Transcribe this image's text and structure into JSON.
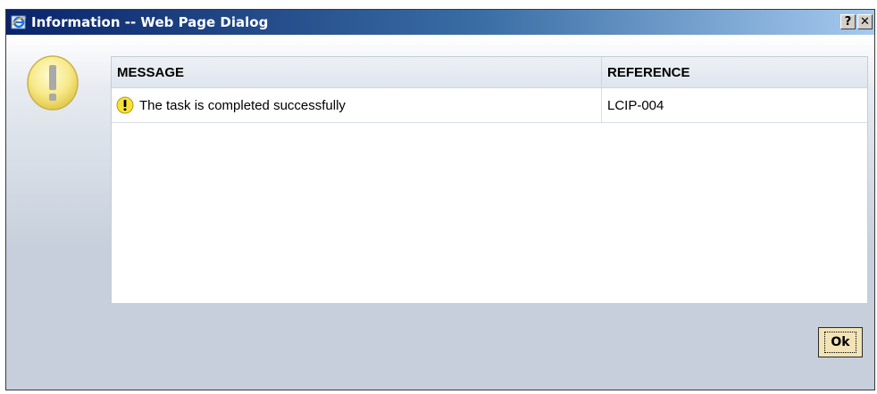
{
  "window": {
    "title": "Information -- Web Page Dialog",
    "help_label": "?",
    "close_label": "✕"
  },
  "table": {
    "headers": {
      "message": "MESSAGE",
      "reference": "REFERENCE"
    },
    "rows": [
      {
        "message": "The task is completed successfully",
        "reference": "LCIP-004",
        "icon": "warning-icon"
      }
    ]
  },
  "footer": {
    "ok_label": "Ok"
  },
  "colors": {
    "title_gradient_start": "#0a246a",
    "title_gradient_end": "#a6caf0",
    "warning_yellow": "#f7e23a",
    "ok_button_bg": "#f2e4b6"
  }
}
